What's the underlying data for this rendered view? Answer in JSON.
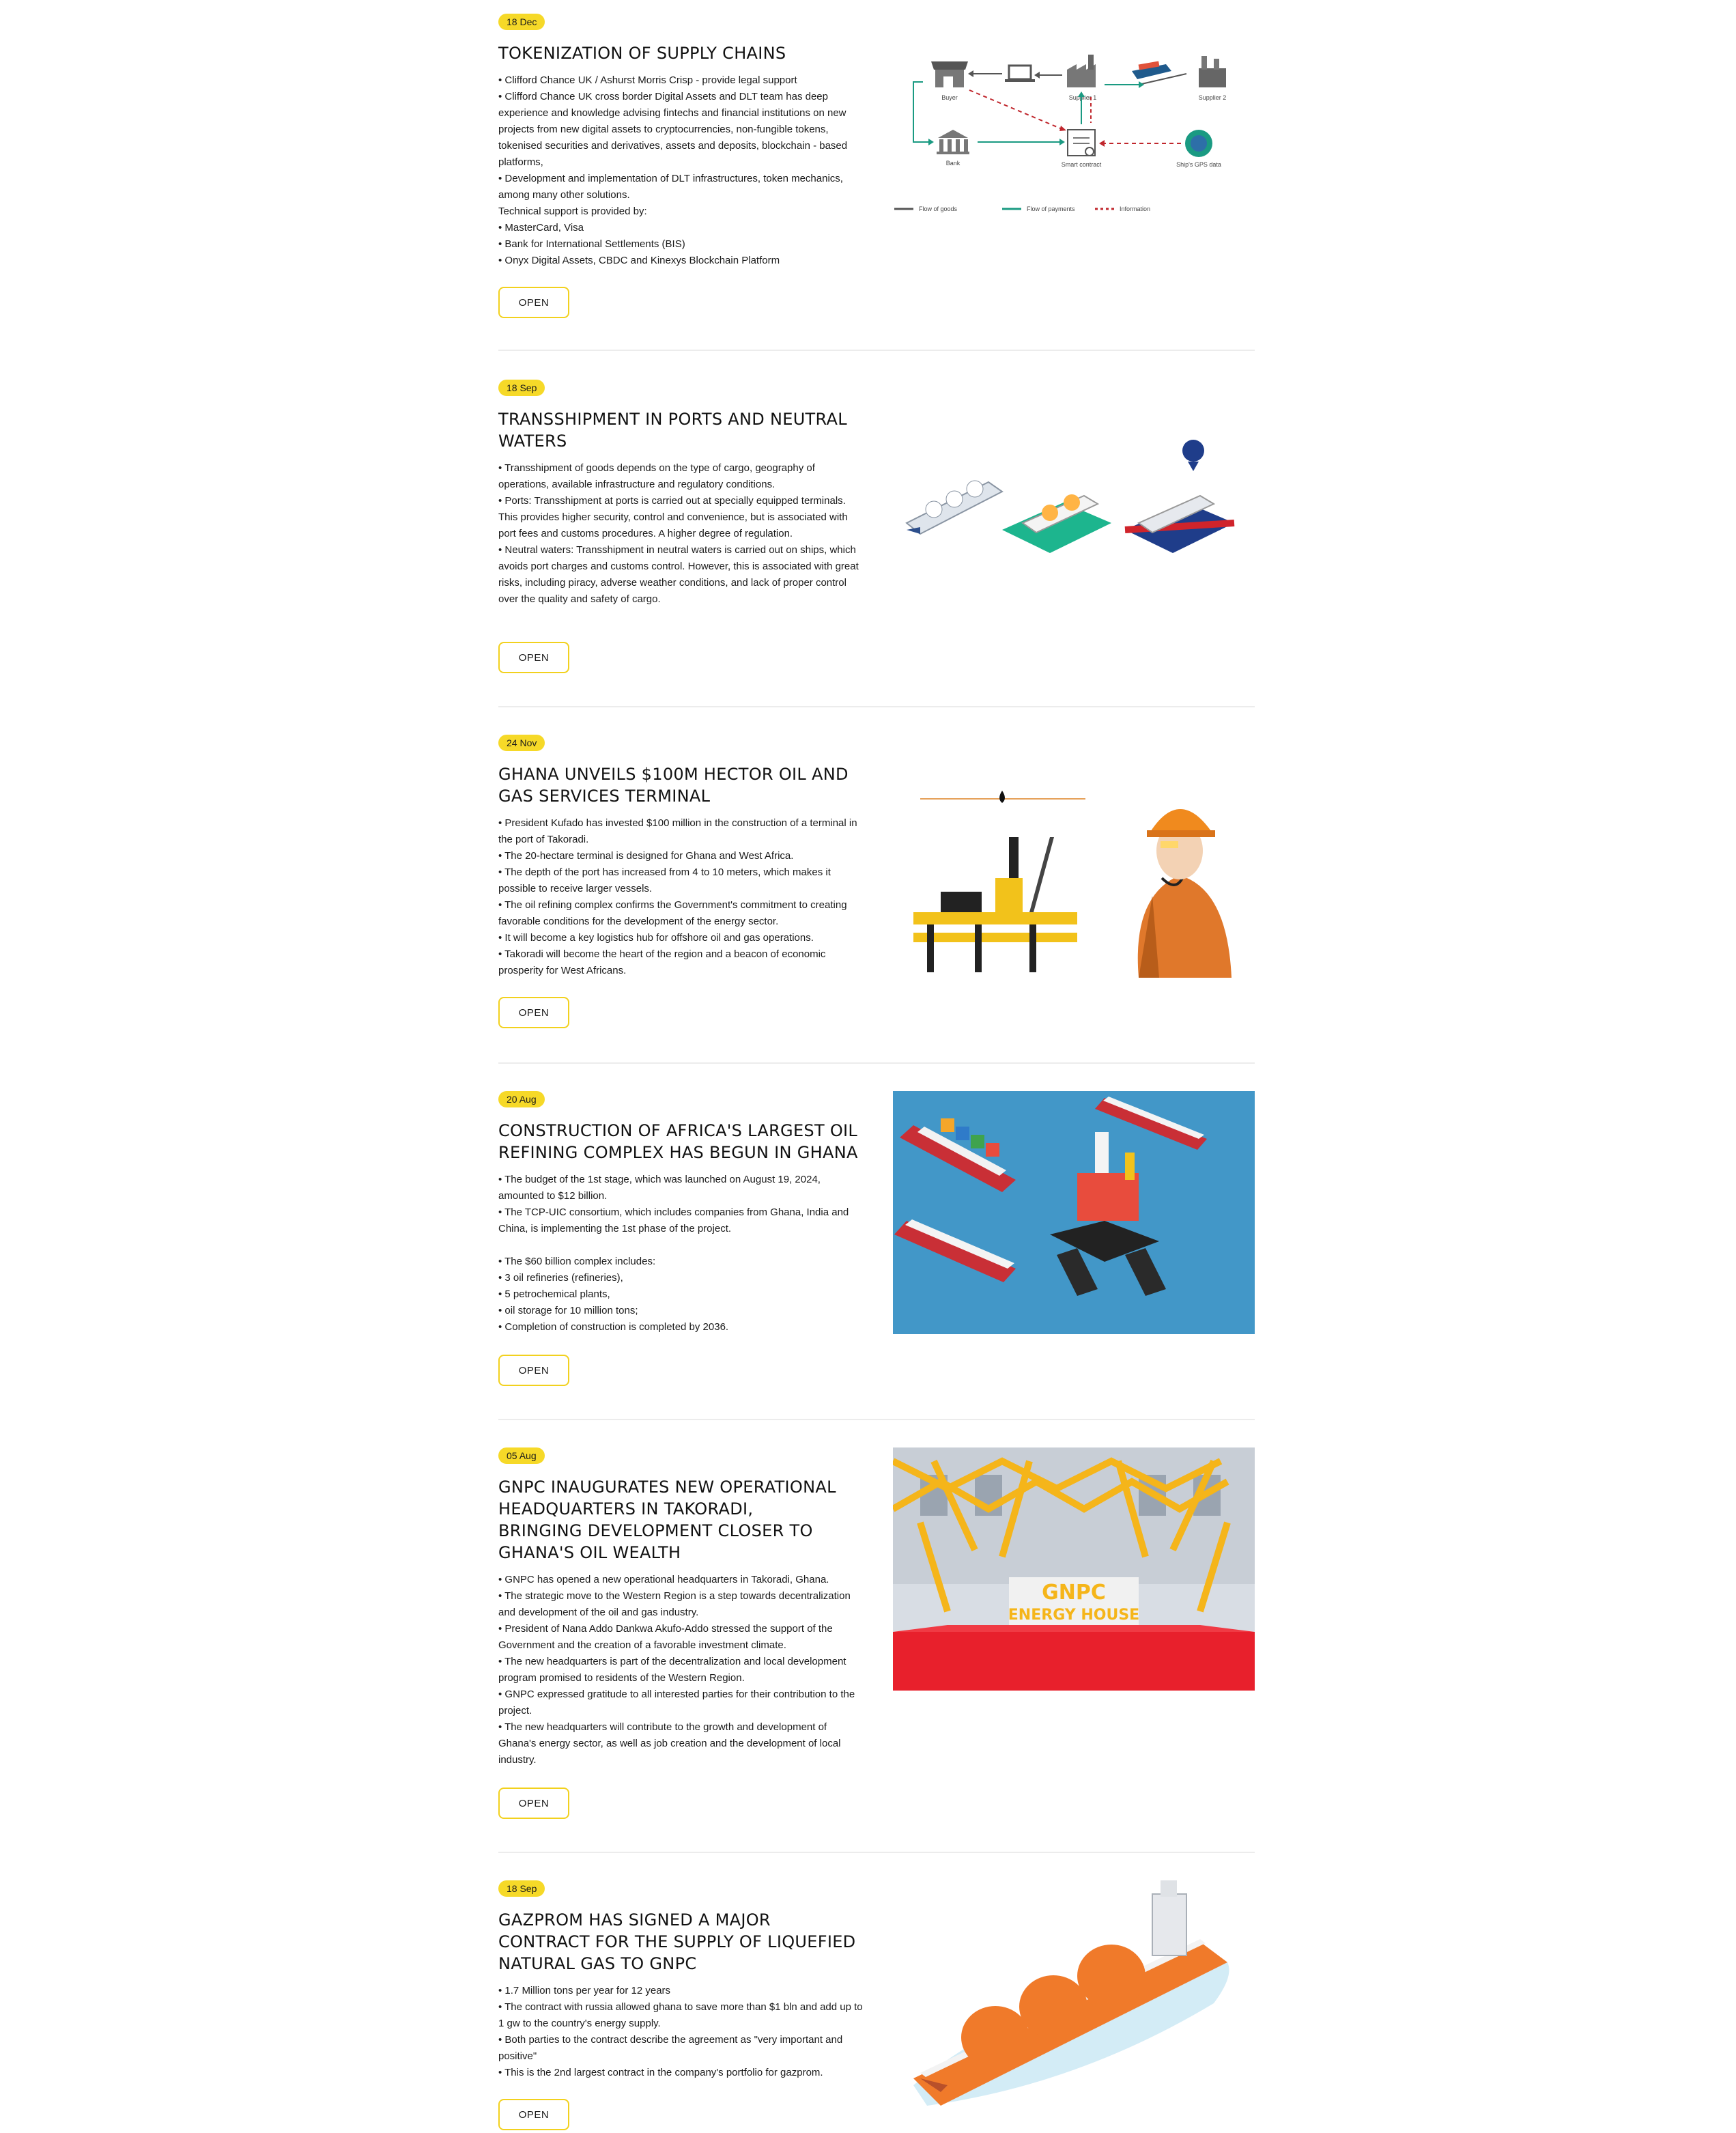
{
  "articles": [
    {
      "date": "18 Dec",
      "title": "TOKENIZATION OF SUPPLY CHAINS",
      "lines": [
        "• Clifford Chance UK / Ashurst Morris Crisp - provide legal support",
        "• Clifford Chance UK cross border Digital Assets and DLT team has deep experience and knowledge advising fintechs and financial institutions on new projects from new digital assets to cryptocurrencies, non-fungible tokens, tokenised securities and derivatives, assets and deposits, blockchain - based platforms,",
        "• Development and implementation of DLT infrastructures, token mechanics, among many other solutions.",
        "Technical support is provided by:",
        "• MasterCard, Visa",
        "• Bank for International Settlements (BIS)",
        "• Onyx Digital Assets, CBDC and Kinexys Blockchain Platform"
      ],
      "button": "OPEN",
      "diagram": {
        "nodes": [
          "Buyer",
          "Supplier 1",
          "Supplier 2",
          "Bank",
          "Smart contract",
          "Ship's GPS data"
        ],
        "legend": [
          "Flow of goods",
          "Flow of payments",
          "Information"
        ],
        "colors": {
          "goods": "#555555",
          "payments": "#1a9a82",
          "information": "#c0272d"
        }
      }
    },
    {
      "date": "18 Sep",
      "title": "TRANSSHIPMENT IN PORTS AND NEUTRAL WATERS",
      "lines": [
        "• Transshipment of goods depends on the type of cargo, geography of operations, available infrastructure and regulatory conditions.",
        "• Ports: Transshipment at ports is carried out at specially equipped terminals. This provides higher security, control and convenience, but is associated with port fees and customs procedures. A higher degree of regulation.",
        "• Neutral waters: Transshipment in neutral waters is carried out on ships, which avoids port charges and customs control. However, this is associated with great risks, including piracy, adverse weather conditions, and lack of proper control over the quality and safety of cargo."
      ],
      "button": "OPEN"
    },
    {
      "date": "24 Nov",
      "title": "GHANA UNVEILS $100M HECTOR OIL AND GAS SERVICES TERMINAL",
      "lines": [
        "• President Kufado has invested $100 million in the construction of a terminal in the port of Takoradi.",
        "• The 20-hectare terminal is designed for Ghana and West Africa.",
        "• The depth of the port has increased from 4 to 10 meters, which makes it possible to receive larger vessels.",
        "• The oil refining complex confirms the Government's commitment to creating favorable conditions for the development of the energy sector.",
        "• It will become a key logistics hub for offshore oil and gas operations.",
        "• Takoradi will become the heart of the region and a beacon of economic prosperity for West Africans."
      ],
      "button": "OPEN"
    },
    {
      "date": "20 Aug",
      "title": "CONSTRUCTION OF AFRICA'S LARGEST OIL REFINING COMPLEX HAS BEGUN IN GHANA",
      "lines": [
        "• The budget of the 1st stage, which was launched on August 19, 2024, amounted to $12 billion.",
        "• The TCP-UIC consortium, which includes companies from Ghana, India and China, is implementing the 1st phase of the project.",
        "",
        "• The $60 billion complex includes:",
        "• 3 oil refineries (refineries),",
        "• 5 petrochemical plants,",
        "• oil storage for 10 million tons;",
        "• Completion of construction is completed by 2036."
      ],
      "button": "OPEN"
    },
    {
      "date": "05 Aug",
      "title": "GNPC INAUGURATES NEW OPERATIONAL HEADQUARTERS IN TAKORADI, BRINGING DEVELOPMENT CLOSER TO GHANA'S OIL WEALTH",
      "lines": [
        "• GNPC has opened a new operational headquarters in Takoradi, Ghana.",
        "• The strategic move to the Western Region is a step towards decentralization and development of the oil and gas industry.",
        "• President of Nana Addo Dankwa Akufo-Addo stressed the support of the Government and the creation of a favorable investment climate.",
        "• The new headquarters is part of the decentralization and local development program promised to residents of the Western Region.",
        "• GNPC expressed gratitude to all interested parties for their contribution to the project.",
        "• The new headquarters will contribute to the growth and development of Ghana's energy sector, as well as job creation and the development of local industry."
      ],
      "button": "OPEN",
      "sign": [
        "GNPC",
        "ENERGY HOUSE"
      ]
    },
    {
      "date": "18 Sep",
      "title": "GAZPROM HAS SIGNED A MAJOR CONTRACT FOR THE SUPPLY OF LIQUEFIED NATURAL GAS TO GNPC",
      "lines": [
        "• 1.7 Million tons per year for 12 years",
        "• The contract with russia allowed ghana to save more than $1 bln and add up to 1 gw to the country's energy supply.",
        "• Both parties to the contract describe the agreement as \"very important and positive\"",
        "• This is the 2nd largest contract in the company's portfolio for gazprom."
      ],
      "button": "OPEN"
    }
  ],
  "colors": {
    "accent": "#f6d928",
    "button_border": "#f2d11e",
    "divider": "#ececec"
  }
}
